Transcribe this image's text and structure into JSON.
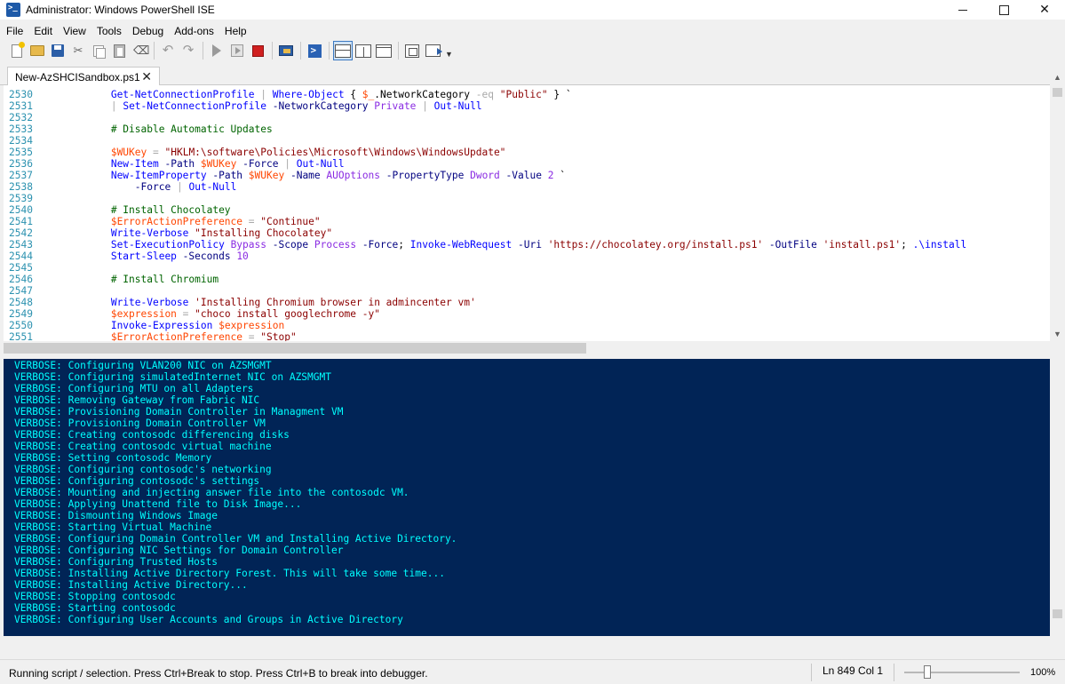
{
  "window": {
    "title": "Administrator: Windows PowerShell ISE"
  },
  "menu": [
    "File",
    "Edit",
    "View",
    "Tools",
    "Debug",
    "Add-ons",
    "Help"
  ],
  "tab": {
    "label": "New-AzSHCISandbox.ps1"
  },
  "editor": {
    "lines": [
      {
        "n": "2530",
        "code": [
          [
            "t-txt",
            "            "
          ],
          [
            "t-cmd",
            "Get-NetConnectionProfile"
          ],
          [
            "t-txt",
            " "
          ],
          [
            "t-op",
            "|"
          ],
          [
            "t-txt",
            " "
          ],
          [
            "t-cmd",
            "Where-Object"
          ],
          [
            "t-txt",
            " { "
          ],
          [
            "t-var",
            "$_"
          ],
          [
            "t-txt",
            ".NetworkCategory "
          ],
          [
            "t-op",
            "-eq"
          ],
          [
            "t-txt",
            " "
          ],
          [
            "t-str",
            "\"Public\""
          ],
          [
            "t-txt",
            " } `"
          ]
        ]
      },
      {
        "n": "2531",
        "code": [
          [
            "t-txt",
            "            "
          ],
          [
            "t-op",
            "|"
          ],
          [
            "t-txt",
            " "
          ],
          [
            "t-cmd",
            "Set-NetConnectionProfile"
          ],
          [
            "t-txt",
            " "
          ],
          [
            "t-par",
            "-NetworkCategory"
          ],
          [
            "t-txt",
            " "
          ],
          [
            "t-arg",
            "Private"
          ],
          [
            "t-txt",
            " "
          ],
          [
            "t-op",
            "|"
          ],
          [
            "t-txt",
            " "
          ],
          [
            "t-cmd",
            "Out-Null"
          ]
        ]
      },
      {
        "n": "2532",
        "code": []
      },
      {
        "n": "2533",
        "code": [
          [
            "t-txt",
            "            "
          ],
          [
            "t-com",
            "# Disable Automatic Updates"
          ]
        ]
      },
      {
        "n": "2534",
        "code": []
      },
      {
        "n": "2535",
        "code": [
          [
            "t-txt",
            "            "
          ],
          [
            "t-var",
            "$WUKey"
          ],
          [
            "t-txt",
            " "
          ],
          [
            "t-op",
            "="
          ],
          [
            "t-txt",
            " "
          ],
          [
            "t-str",
            "\"HKLM:\\software\\Policies\\Microsoft\\Windows\\WindowsUpdate\""
          ]
        ]
      },
      {
        "n": "2536",
        "code": [
          [
            "t-txt",
            "            "
          ],
          [
            "t-cmd",
            "New-Item"
          ],
          [
            "t-txt",
            " "
          ],
          [
            "t-par",
            "-Path"
          ],
          [
            "t-txt",
            " "
          ],
          [
            "t-var",
            "$WUKey"
          ],
          [
            "t-txt",
            " "
          ],
          [
            "t-par",
            "-Force"
          ],
          [
            "t-txt",
            " "
          ],
          [
            "t-op",
            "|"
          ],
          [
            "t-txt",
            " "
          ],
          [
            "t-cmd",
            "Out-Null"
          ]
        ]
      },
      {
        "n": "2537",
        "code": [
          [
            "t-txt",
            "            "
          ],
          [
            "t-cmd",
            "New-ItemProperty"
          ],
          [
            "t-txt",
            " "
          ],
          [
            "t-par",
            "-Path"
          ],
          [
            "t-txt",
            " "
          ],
          [
            "t-var",
            "$WUKey"
          ],
          [
            "t-txt",
            " "
          ],
          [
            "t-par",
            "-Name"
          ],
          [
            "t-txt",
            " "
          ],
          [
            "t-arg",
            "AUOptions"
          ],
          [
            "t-txt",
            " "
          ],
          [
            "t-par",
            "-PropertyType"
          ],
          [
            "t-txt",
            " "
          ],
          [
            "t-arg",
            "Dword"
          ],
          [
            "t-txt",
            " "
          ],
          [
            "t-par",
            "-Value"
          ],
          [
            "t-txt",
            " "
          ],
          [
            "t-arg",
            "2"
          ],
          [
            "t-txt",
            " `"
          ]
        ]
      },
      {
        "n": "2538",
        "code": [
          [
            "t-txt",
            "                "
          ],
          [
            "t-par",
            "-Force"
          ],
          [
            "t-txt",
            " "
          ],
          [
            "t-op",
            "|"
          ],
          [
            "t-txt",
            " "
          ],
          [
            "t-cmd",
            "Out-Null"
          ]
        ]
      },
      {
        "n": "2539",
        "code": []
      },
      {
        "n": "2540",
        "code": [
          [
            "t-txt",
            "            "
          ],
          [
            "t-com",
            "# Install Chocolatey"
          ]
        ]
      },
      {
        "n": "2541",
        "code": [
          [
            "t-txt",
            "            "
          ],
          [
            "t-var",
            "$ErrorActionPreference"
          ],
          [
            "t-txt",
            " "
          ],
          [
            "t-op",
            "="
          ],
          [
            "t-txt",
            " "
          ],
          [
            "t-str",
            "\"Continue\""
          ]
        ]
      },
      {
        "n": "2542",
        "code": [
          [
            "t-txt",
            "            "
          ],
          [
            "t-cmd",
            "Write-Verbose"
          ],
          [
            "t-txt",
            " "
          ],
          [
            "t-str",
            "\"Installing Chocolatey\""
          ]
        ]
      },
      {
        "n": "2543",
        "code": [
          [
            "t-txt",
            "            "
          ],
          [
            "t-cmd",
            "Set-ExecutionPolicy"
          ],
          [
            "t-txt",
            " "
          ],
          [
            "t-arg",
            "Bypass"
          ],
          [
            "t-txt",
            " "
          ],
          [
            "t-par",
            "-Scope"
          ],
          [
            "t-txt",
            " "
          ],
          [
            "t-arg",
            "Process"
          ],
          [
            "t-txt",
            " "
          ],
          [
            "t-par",
            "-Force"
          ],
          [
            "t-txt",
            "; "
          ],
          [
            "t-cmd",
            "Invoke-WebRequest"
          ],
          [
            "t-txt",
            " "
          ],
          [
            "t-par",
            "-Uri"
          ],
          [
            "t-txt",
            " "
          ],
          [
            "t-str",
            "'https://chocolatey.org/install.ps1'"
          ],
          [
            "t-txt",
            " "
          ],
          [
            "t-par",
            "-OutFile"
          ],
          [
            "t-txt",
            " "
          ],
          [
            "t-str",
            "'install.ps1'"
          ],
          [
            "t-txt",
            "; "
          ],
          [
            "t-cmd",
            ".\\install"
          ]
        ]
      },
      {
        "n": "2544",
        "code": [
          [
            "t-txt",
            "            "
          ],
          [
            "t-cmd",
            "Start-Sleep"
          ],
          [
            "t-txt",
            " "
          ],
          [
            "t-par",
            "-Seconds"
          ],
          [
            "t-txt",
            " "
          ],
          [
            "t-arg",
            "10"
          ]
        ]
      },
      {
        "n": "2545",
        "code": []
      },
      {
        "n": "2546",
        "code": [
          [
            "t-txt",
            "            "
          ],
          [
            "t-com",
            "# Install Chromium"
          ]
        ]
      },
      {
        "n": "2547",
        "code": []
      },
      {
        "n": "2548",
        "code": [
          [
            "t-txt",
            "            "
          ],
          [
            "t-cmd",
            "Write-Verbose"
          ],
          [
            "t-txt",
            " "
          ],
          [
            "t-str",
            "'Installing Chromium browser in admincenter vm'"
          ]
        ]
      },
      {
        "n": "2549",
        "code": [
          [
            "t-txt",
            "            "
          ],
          [
            "t-var",
            "$expression"
          ],
          [
            "t-txt",
            " "
          ],
          [
            "t-op",
            "="
          ],
          [
            "t-txt",
            " "
          ],
          [
            "t-str",
            "\"choco install googlechrome -y\""
          ]
        ]
      },
      {
        "n": "2550",
        "code": [
          [
            "t-txt",
            "            "
          ],
          [
            "t-cmd",
            "Invoke-Expression"
          ],
          [
            "t-txt",
            " "
          ],
          [
            "t-var",
            "$expression"
          ]
        ]
      },
      {
        "n": "2551",
        "code": [
          [
            "t-txt",
            "            "
          ],
          [
            "t-var",
            "$ErrorActionPreference"
          ],
          [
            "t-txt",
            " "
          ],
          [
            "t-op",
            "="
          ],
          [
            "t-txt",
            " "
          ],
          [
            "t-str",
            "\"Stop\""
          ]
        ]
      }
    ]
  },
  "console": {
    "lines": [
      "VERBOSE: Configuring VLAN200 NIC on AZSMGMT",
      "VERBOSE: Configuring simulatedInternet NIC on AZSMGMT",
      "VERBOSE: Configuring MTU on all Adapters",
      "VERBOSE: Removing Gateway from Fabric NIC",
      "VERBOSE: Provisioning Domain Controller in Managment VM",
      "VERBOSE: Provisioning Domain Controller VM",
      "VERBOSE: Creating contosodc differencing disks",
      "VERBOSE: Creating contosodc virtual machine",
      "VERBOSE: Setting contosodc Memory",
      "VERBOSE: Configuring contosodc's networking",
      "VERBOSE: Configuring contosodc's settings",
      "VERBOSE: Mounting and injecting answer file into the contosodc VM.",
      "VERBOSE: Applying Unattend file to Disk Image...",
      "VERBOSE: Dismounting Windows Image",
      "VERBOSE: Starting Virtual Machine",
      "VERBOSE: Configuring Domain Controller VM and Installing Active Directory.",
      "VERBOSE: Configuring NIC Settings for Domain Controller",
      "VERBOSE: Configuring Trusted Hosts",
      "VERBOSE: Installing Active Directory Forest. This will take some time...",
      "VERBOSE: Installing Active Directory...",
      "VERBOSE: Stopping contosodc",
      "VERBOSE: Starting contosodc",
      "VERBOSE: Configuring User Accounts and Groups in Active Directory"
    ]
  },
  "status": {
    "message": "Running script / selection.  Press Ctrl+Break to stop.  Press Ctrl+B to break into debugger.",
    "position": "Ln 849  Col 1",
    "zoom": "100%",
    "zoom_fraction": 0.2
  },
  "colors": {
    "console_bg": "#012456",
    "console_text": "#00ffff",
    "stop_button": "#d02020"
  }
}
